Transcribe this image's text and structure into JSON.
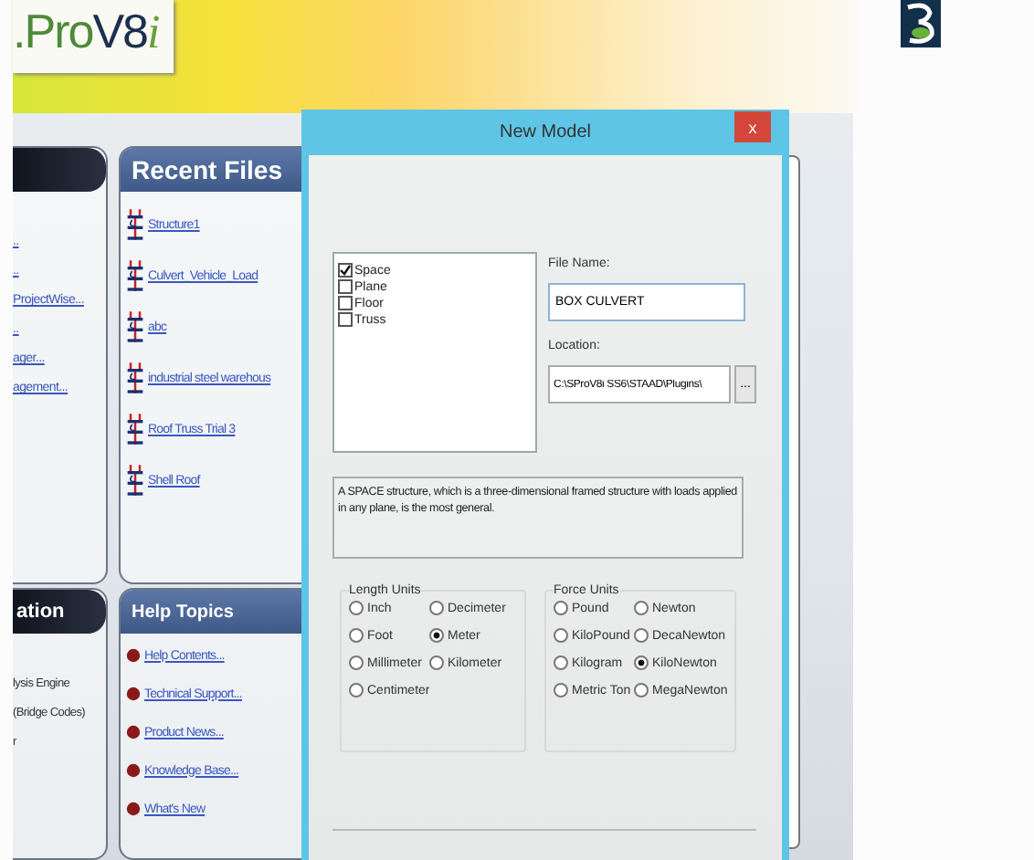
{
  "banner": {
    "logo": {
      "prefix": ".Pro",
      "version": "V8",
      "suffix": "i"
    }
  },
  "left_panel": {
    "items": [
      "..",
      "..",
      "ProjectWise...",
      "..",
      "ager...",
      "agement..."
    ]
  },
  "left_panel_2": {
    "header": "ation",
    "items": [
      "lysis Engine",
      "(Bridge Codes)",
      "r"
    ]
  },
  "recent_files": {
    "header": "Recent Files",
    "items": [
      "Structure1",
      "Culvert_Vehicle_Load",
      "abc",
      "industrial steel warehous",
      "Roof Truss Trial 3",
      "Shell Roof"
    ]
  },
  "help_topics": {
    "header": "Help Topics",
    "items": [
      "Help Contents...",
      "Technical Support...",
      "Product News...",
      "Knowledge Base...",
      "What's New"
    ]
  },
  "dialog": {
    "title": "New Model",
    "close": "x",
    "structure_types": [
      {
        "label": "Space",
        "checked": true
      },
      {
        "label": "Plane",
        "checked": false
      },
      {
        "label": "Floor",
        "checked": false
      },
      {
        "label": "Truss",
        "checked": false
      }
    ],
    "file_name": {
      "label": "File Name:",
      "value": "BOX CULVERT"
    },
    "location": {
      "label": "Location:",
      "value": "C:\\SProV8i SS6\\STAAD\\Plugins\\",
      "browse": "..."
    },
    "description": "A SPACE structure, which is a three-dimensional framed structure with loads applied in any plane, is the most general.",
    "length_units": {
      "label": "Length Units",
      "options": [
        {
          "label": "Inch",
          "selected": false
        },
        {
          "label": "Decimeter",
          "selected": false
        },
        {
          "label": "Foot",
          "selected": false
        },
        {
          "label": "Meter",
          "selected": true
        },
        {
          "label": "Millimeter",
          "selected": false
        },
        {
          "label": "Kilometer",
          "selected": false
        },
        {
          "label": "Centimeter",
          "selected": false
        }
      ]
    },
    "force_units": {
      "label": "Force Units",
      "options": [
        {
          "label": "Pound",
          "selected": false
        },
        {
          "label": "Newton",
          "selected": false
        },
        {
          "label": "KiloPound",
          "selected": false
        },
        {
          "label": "DecaNewton",
          "selected": false
        },
        {
          "label": "Kilogram",
          "selected": false
        },
        {
          "label": "KiloNewton",
          "selected": true
        },
        {
          "label": "Metric Ton",
          "selected": false
        },
        {
          "label": "MegaNewton",
          "selected": false
        }
      ]
    }
  }
}
